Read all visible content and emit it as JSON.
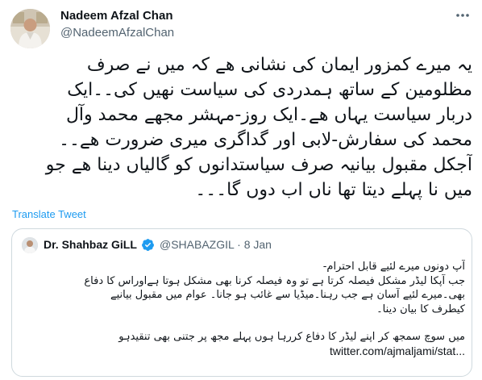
{
  "tweet": {
    "author_name": "Nadeem Afzal Chan",
    "author_handle": "@NadeemAfzalChan",
    "more_icon": "more-dots-icon",
    "body_lines": [
      "یہ میرے کمزور ایمان کی نشانی ھے کہ میں نے صرف",
      "مظلومین کے ساتھ ہمدردی کی سیاست نھیں کی۔۔ایک",
      "دربار سیاست یہاں ھے۔ایک روز-مہشر مجھے محمد وآل",
      "محمد کی سفارش-لابی اور گداگری میری ضرورت ھے۔۔",
      "آجکل مقبول بیانیہ صرف سیاستدانوں کو گالیاں دینا ھے جو",
      "میں نا پہلے دیتا تھا ناں اب دوں گا۔۔۔"
    ],
    "translate_label": "Translate Tweet"
  },
  "quote": {
    "author_name": "Dr. Shahbaz GiLL",
    "author_handle": "@SHABAZGIL · 8 Jan",
    "verified_icon": "verified-badge-icon",
    "lines": [
      "آپ دونوں میرے لئیے قابل احترام-",
      "جب آپکا لیڈر مشکل فیصلہ کرتا ہے تو وہ فیصلہ کرنا بھی مشکل ہوتا ہےاوراس کا دفاع",
      "بھی۔میرے لئیے آسان ہے جب رہنا۔میڈیا سے غائب ہو جانا۔ عوام میں مقبول بیانیے",
      "کیطرف کا بیان دینا۔"
    ],
    "lines_2": [
      "میں سوچ سمجھ کر اپنے لیڈر کا دفاع کررہا ہوں پہلے مجھ پر جتنی بھی تنقیدہو"
    ],
    "link": "twitter.com/ajmaljami/stat..."
  }
}
